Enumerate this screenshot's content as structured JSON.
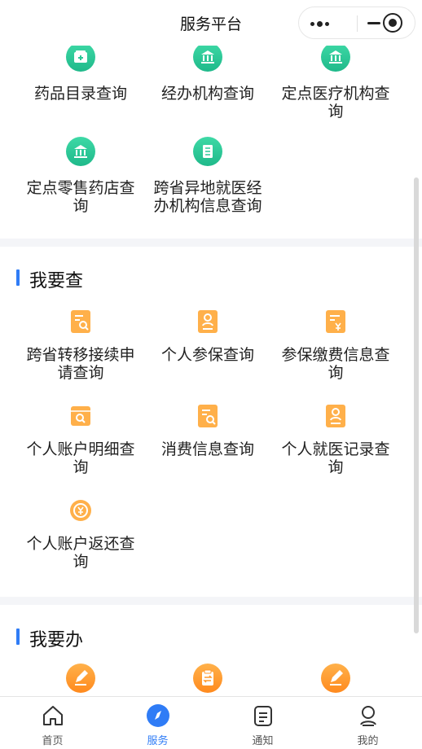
{
  "header": {
    "title": "服务平台"
  },
  "top_items": [
    {
      "label": "药品目录查询",
      "icon": "medicine-box-icon"
    },
    {
      "label": "经办机构查询",
      "icon": "building-icon"
    },
    {
      "label": "定点医疗机构查询",
      "icon": "building-icon"
    },
    {
      "label": "定点零售药店查询",
      "icon": "building-icon"
    },
    {
      "label": "跨省异地就医经办机构信息查询",
      "icon": "list-doc-icon"
    }
  ],
  "query_section": {
    "title": "我要查",
    "items": [
      {
        "label": "跨省转移接续申请查询",
        "icon": "doc-search-icon"
      },
      {
        "label": "个人参保查询",
        "icon": "person-doc-icon"
      },
      {
        "label": "参保缴费信息查询",
        "icon": "doc-yen-icon"
      },
      {
        "label": "个人账户明细查询",
        "icon": "folder-search-icon"
      },
      {
        "label": "消费信息查询",
        "icon": "doc-search-icon"
      },
      {
        "label": "个人就医记录查询",
        "icon": "person-doc-icon"
      },
      {
        "label": "个人账户返还查询",
        "icon": "yen-return-icon"
      }
    ]
  },
  "handle_section": {
    "title": "我要办",
    "items": [
      {
        "icon": "edit-icon"
      },
      {
        "icon": "transfer-doc-icon"
      },
      {
        "icon": "edit-icon"
      }
    ]
  },
  "tabbar": {
    "items": [
      {
        "label": "首页",
        "icon": "home-icon"
      },
      {
        "label": "服务",
        "icon": "compass-icon",
        "active": true
      },
      {
        "label": "通知",
        "icon": "clipboard-icon"
      },
      {
        "label": "我的",
        "icon": "user-icon"
      }
    ]
  },
  "colors": {
    "accent": "#2f7cf6",
    "green": "#2cc898",
    "orange": "#ff9a2e"
  }
}
